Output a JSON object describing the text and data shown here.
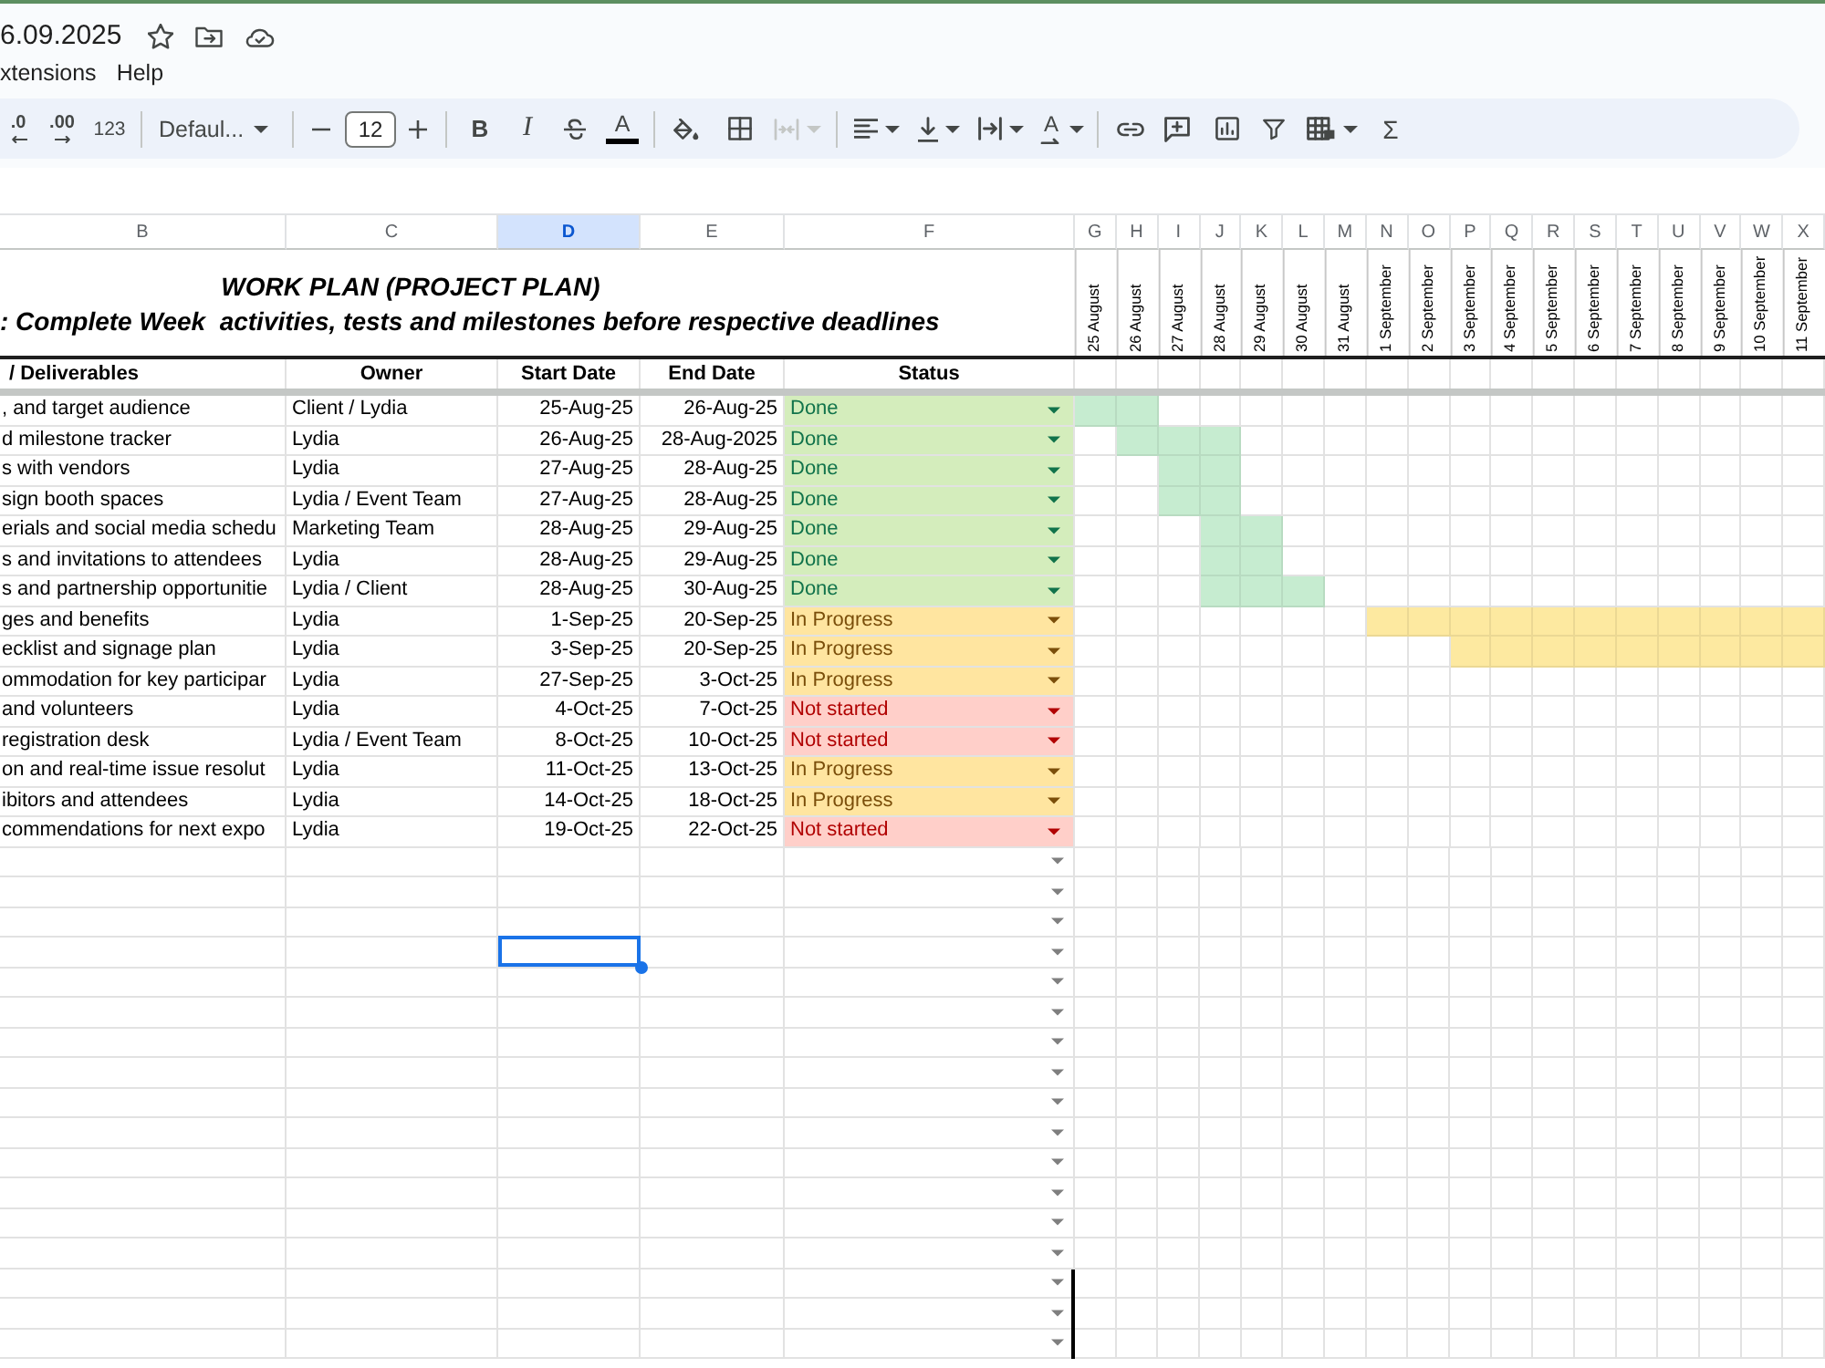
{
  "document": {
    "title": "6.09.2025",
    "menu": [
      "xtensions",
      "Help"
    ]
  },
  "toolbar": {
    "decrease_decimal": ".0",
    "increase_decimal": ".00",
    "number_format": "123",
    "font": "Defaul...",
    "font_size": "12",
    "bold": "B",
    "italic": "I",
    "text_color": "A",
    "text_rotation": "A",
    "functions": "Σ",
    "merge": {
      "disabled": true
    }
  },
  "columns": [
    {
      "label": "B",
      "selected": false
    },
    {
      "label": "C",
      "selected": false
    },
    {
      "label": "D",
      "selected": true
    },
    {
      "label": "E",
      "selected": false
    },
    {
      "label": "F",
      "selected": false
    },
    {
      "label": "G",
      "selected": false
    },
    {
      "label": "H",
      "selected": false
    },
    {
      "label": "I",
      "selected": false
    },
    {
      "label": "J",
      "selected": false
    },
    {
      "label": "K",
      "selected": false
    },
    {
      "label": "L",
      "selected": false
    },
    {
      "label": "M",
      "selected": false
    },
    {
      "label": "N",
      "selected": false
    },
    {
      "label": "O",
      "selected": false
    },
    {
      "label": "P",
      "selected": false
    },
    {
      "label": "Q",
      "selected": false
    },
    {
      "label": "R",
      "selected": false
    },
    {
      "label": "S",
      "selected": false
    },
    {
      "label": "T",
      "selected": false
    },
    {
      "label": "U",
      "selected": false
    },
    {
      "label": "V",
      "selected": false
    },
    {
      "label": "W",
      "selected": false
    },
    {
      "label": "X",
      "selected": false
    }
  ],
  "sheet": {
    "title_lines": [
      "WORK PLAN (PROJECT PLAN)",
      ": Complete Week  activities, tests and milestones before respective deadlines"
    ],
    "dates": [
      "25 August",
      "26 August",
      "27 August",
      "28 August",
      "29 August",
      "30 August",
      "31 August",
      "1 September",
      "2 September",
      "3 September",
      "4 September",
      "5 September",
      "6 September",
      "7 September",
      "8 September",
      "9 September",
      "10 September",
      "11 September"
    ],
    "headers": [
      "/ Deliverables",
      "Owner",
      "Start Date",
      "End Date",
      "Status"
    ],
    "tasks": [
      {
        "task": ", and target audience",
        "owner": "Client / Lydia",
        "start": "25-Aug-25",
        "end": "26-Aug-25",
        "status": {
          "label": "Done",
          "kind": "done"
        },
        "timeline": [
          true,
          true,
          false,
          false,
          false,
          false,
          false,
          false,
          false,
          false,
          false,
          false,
          false,
          false,
          false,
          false,
          false,
          false
        ]
      },
      {
        "task": "d milestone tracker",
        "owner": "Lydia",
        "start": "26-Aug-25",
        "end": "28-Aug-2025",
        "status": {
          "label": "Done",
          "kind": "done"
        },
        "timeline": [
          false,
          true,
          true,
          true,
          false,
          false,
          false,
          false,
          false,
          false,
          false,
          false,
          false,
          false,
          false,
          false,
          false,
          false
        ]
      },
      {
        "task": "s with vendors",
        "owner": "Lydia",
        "start": "27-Aug-25",
        "end": "28-Aug-25",
        "status": {
          "label": "Done",
          "kind": "done"
        },
        "timeline": [
          false,
          false,
          true,
          true,
          false,
          false,
          false,
          false,
          false,
          false,
          false,
          false,
          false,
          false,
          false,
          false,
          false,
          false
        ]
      },
      {
        "task": "sign booth spaces",
        "owner": "Lydia / Event Team",
        "start": "27-Aug-25",
        "end": "28-Aug-25",
        "status": {
          "label": "Done",
          "kind": "done"
        },
        "timeline": [
          false,
          false,
          true,
          true,
          false,
          false,
          false,
          false,
          false,
          false,
          false,
          false,
          false,
          false,
          false,
          false,
          false,
          false
        ]
      },
      {
        "task": "erials and social media schedu",
        "owner": "Marketing Team",
        "start": "28-Aug-25",
        "end": "29-Aug-25",
        "status": {
          "label": "Done",
          "kind": "done"
        },
        "timeline": [
          false,
          false,
          false,
          true,
          true,
          false,
          false,
          false,
          false,
          false,
          false,
          false,
          false,
          false,
          false,
          false,
          false,
          false
        ]
      },
      {
        "task": "s and invitations to attendees",
        "owner": "Lydia",
        "start": "28-Aug-25",
        "end": "29-Aug-25",
        "status": {
          "label": "Done",
          "kind": "done"
        },
        "timeline": [
          false,
          false,
          false,
          true,
          true,
          false,
          false,
          false,
          false,
          false,
          false,
          false,
          false,
          false,
          false,
          false,
          false,
          false
        ]
      },
      {
        "task": "s and partnership opportunitie",
        "owner": "Lydia / Client",
        "start": "28-Aug-25",
        "end": "30-Aug-25",
        "status": {
          "label": "Done",
          "kind": "done"
        },
        "timeline": [
          false,
          false,
          false,
          true,
          true,
          true,
          false,
          false,
          false,
          false,
          false,
          false,
          false,
          false,
          false,
          false,
          false,
          false
        ]
      },
      {
        "task": "ges and benefits",
        "owner": "Lydia",
        "start": "1-Sep-25",
        "end": "20-Sep-25",
        "status": {
          "label": "In Progress",
          "kind": "in_progress"
        },
        "timeline": [
          false,
          false,
          false,
          false,
          false,
          false,
          false,
          true,
          true,
          true,
          true,
          true,
          true,
          true,
          true,
          true,
          true,
          true
        ]
      },
      {
        "task": "ecklist and signage plan",
        "owner": "Lydia",
        "start": "3-Sep-25",
        "end": "20-Sep-25",
        "status": {
          "label": "In Progress",
          "kind": "in_progress"
        },
        "timeline": [
          false,
          false,
          false,
          false,
          false,
          false,
          false,
          false,
          false,
          true,
          true,
          true,
          true,
          true,
          true,
          true,
          true,
          true
        ]
      },
      {
        "task": "ommodation for key participar",
        "owner": "Lydia",
        "start": "27-Sep-25",
        "end": "3-Oct-25",
        "status": {
          "label": "In Progress",
          "kind": "in_progress"
        },
        "timeline": [
          false,
          false,
          false,
          false,
          false,
          false,
          false,
          false,
          false,
          false,
          false,
          false,
          false,
          false,
          false,
          false,
          false,
          false
        ]
      },
      {
        "task": "and volunteers",
        "owner": "Lydia",
        "start": "4-Oct-25",
        "end": "7-Oct-25",
        "status": {
          "label": "Not started",
          "kind": "not_started"
        },
        "timeline": [
          false,
          false,
          false,
          false,
          false,
          false,
          false,
          false,
          false,
          false,
          false,
          false,
          false,
          false,
          false,
          false,
          false,
          false
        ]
      },
      {
        "task": "registration desk",
        "owner": "Lydia / Event Team",
        "start": "8-Oct-25",
        "end": "10-Oct-25",
        "status": {
          "label": "Not started",
          "kind": "not_started"
        },
        "timeline": [
          false,
          false,
          false,
          false,
          false,
          false,
          false,
          false,
          false,
          false,
          false,
          false,
          false,
          false,
          false,
          false,
          false,
          false
        ]
      },
      {
        "task": "on and real-time issue resolut",
        "owner": "Lydia",
        "start": "11-Oct-25",
        "end": "13-Oct-25",
        "status": {
          "label": "In Progress",
          "kind": "in_progress"
        },
        "timeline": [
          false,
          false,
          false,
          false,
          false,
          false,
          false,
          false,
          false,
          false,
          false,
          false,
          false,
          false,
          false,
          false,
          false,
          false
        ]
      },
      {
        "task": "ibitors and attendees",
        "owner": "Lydia",
        "start": "14-Oct-25",
        "end": "18-Oct-25",
        "status": {
          "label": "In Progress",
          "kind": "in_progress"
        },
        "timeline": [
          false,
          false,
          false,
          false,
          false,
          false,
          false,
          false,
          false,
          false,
          false,
          false,
          false,
          false,
          false,
          false,
          false,
          false
        ]
      },
      {
        "task": "commendations for next expo",
        "owner": "Lydia",
        "start": "19-Oct-25",
        "end": "22-Oct-25",
        "status": {
          "label": "Not started",
          "kind": "not_started"
        },
        "timeline": [
          false,
          false,
          false,
          false,
          false,
          false,
          false,
          false,
          false,
          false,
          false,
          false,
          false,
          false,
          false,
          false,
          false,
          false
        ]
      }
    ],
    "blank_rows": [
      {
        "selected": false,
        "border_right": false
      },
      {
        "selected": false,
        "border_right": false
      },
      {
        "selected": false,
        "border_right": false
      },
      {
        "selected": true,
        "border_right": false
      },
      {
        "selected": false,
        "border_right": false
      },
      {
        "selected": false,
        "border_right": false
      },
      {
        "selected": false,
        "border_right": false
      },
      {
        "selected": false,
        "border_right": false
      },
      {
        "selected": false,
        "border_right": false
      },
      {
        "selected": false,
        "border_right": false
      },
      {
        "selected": false,
        "border_right": false
      },
      {
        "selected": false,
        "border_right": false
      },
      {
        "selected": false,
        "border_right": false
      },
      {
        "selected": false,
        "border_right": false
      },
      {
        "selected": false,
        "border_right": true
      },
      {
        "selected": false,
        "border_right": true
      },
      {
        "selected": false,
        "border_right": true
      }
    ]
  }
}
